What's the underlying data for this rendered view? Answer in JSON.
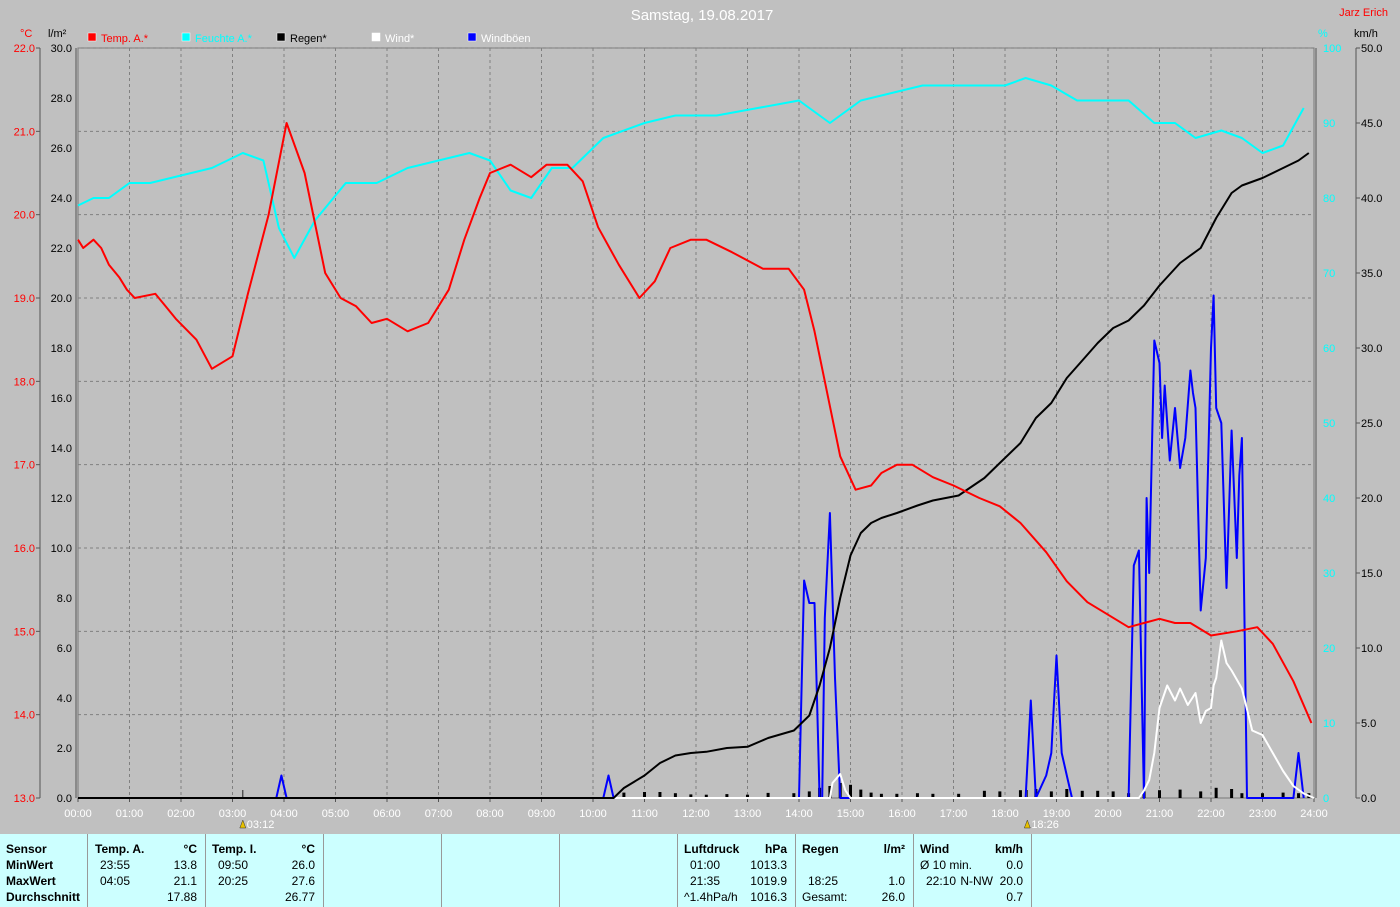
{
  "header": {
    "title": "Samstag, 19.08.2017",
    "author": "Jarz Erich"
  },
  "axes": {
    "left_outer_unit": "°C",
    "left_inner_unit": "l/m²",
    "right_inner_unit": "%",
    "right_outer_unit": "km/h",
    "temp_ticks": [
      "13.0",
      "14.0",
      "15.0",
      "16.0",
      "17.0",
      "18.0",
      "19.0",
      "20.0",
      "21.0",
      "22.0"
    ],
    "rain_ticks": [
      "0.0",
      "2.0",
      "4.0",
      "6.0",
      "8.0",
      "10.0",
      "12.0",
      "14.0",
      "16.0",
      "18.0",
      "20.0",
      "22.0",
      "24.0",
      "26.0",
      "28.0",
      "30.0"
    ],
    "hum_ticks": [
      "0",
      "10",
      "20",
      "30",
      "40",
      "50",
      "60",
      "70",
      "80",
      "90",
      "100"
    ],
    "wind_ticks": [
      "0.0",
      "5.0",
      "10.0",
      "15.0",
      "20.0",
      "25.0",
      "30.0",
      "35.0",
      "40.0",
      "45.0",
      "50.0"
    ],
    "time_ticks": [
      "00:00",
      "01:00",
      "02:00",
      "03:00",
      "04:00",
      "05:00",
      "06:00",
      "07:00",
      "08:00",
      "09:00",
      "10:00",
      "11:00",
      "12:00",
      "13:00",
      "14:00",
      "15:00",
      "16:00",
      "17:00",
      "18:00",
      "19:00",
      "20:00",
      "21:00",
      "22:00",
      "23:00",
      "24:00"
    ],
    "sunrise": "03:12",
    "sunset": "18:26"
  },
  "legend": [
    {
      "label": "Temp. A.*",
      "color": "#ff0000"
    },
    {
      "label": "Feuchte A.*",
      "color": "#00ffff"
    },
    {
      "label": "Regen*",
      "color": "#000000"
    },
    {
      "label": "Wind*",
      "color": "#ffffff"
    },
    {
      "label": "Windböen",
      "color": "#0000ff"
    }
  ],
  "chart_data": {
    "type": "line",
    "x_unit": "hours",
    "ylim_temp": [
      13.0,
      22.0
    ],
    "ylim_rain": [
      0,
      30
    ],
    "ylim_humidity": [
      0,
      100
    ],
    "ylim_wind": [
      0,
      50
    ],
    "series": [
      {
        "name": "Temp. A.*",
        "axis": "temp",
        "color": "#ff0000",
        "x": [
          0,
          0.1,
          0.3,
          0.45,
          0.6,
          0.8,
          0.95,
          1.1,
          1.5,
          1.7,
          1.9,
          2.3,
          2.6,
          3.0,
          3.3,
          3.7,
          4.05,
          4.4,
          4.8,
          5.1,
          5.4,
          5.7,
          6.0,
          6.4,
          6.8,
          7.2,
          7.5,
          7.8,
          8.0,
          8.4,
          8.8,
          9.1,
          9.5,
          9.8,
          10.1,
          10.5,
          10.9,
          11.2,
          11.5,
          11.9,
          12.2,
          12.7,
          13.3,
          13.8,
          14.1,
          14.3,
          14.5,
          14.8,
          15.1,
          15.4,
          15.6,
          15.9,
          16.2,
          16.6,
          17.0,
          17.5,
          17.9,
          18.3,
          18.8,
          19.2,
          19.6,
          20.0,
          20.4,
          20.7,
          21.0,
          21.3,
          21.6,
          22.0,
          22.5,
          22.9,
          23.2,
          23.6,
          23.95
        ],
        "y": [
          19.7,
          19.6,
          19.7,
          19.6,
          19.4,
          19.25,
          19.1,
          19.0,
          19.05,
          18.9,
          18.75,
          18.5,
          18.15,
          18.3,
          19.05,
          20.0,
          21.1,
          20.5,
          19.3,
          19.0,
          18.9,
          18.7,
          18.75,
          18.6,
          18.7,
          19.1,
          19.7,
          20.2,
          20.5,
          20.6,
          20.45,
          20.6,
          20.6,
          20.4,
          19.85,
          19.4,
          19.0,
          19.2,
          19.6,
          19.7,
          19.7,
          19.55,
          19.35,
          19.35,
          19.1,
          18.6,
          18.0,
          17.1,
          16.7,
          16.75,
          16.9,
          17.0,
          17.0,
          16.85,
          16.75,
          16.6,
          16.5,
          16.3,
          15.95,
          15.6,
          15.35,
          15.2,
          15.05,
          15.1,
          15.15,
          15.1,
          15.1,
          14.95,
          15.0,
          15.05,
          14.85,
          14.4,
          13.9
        ]
      },
      {
        "name": "Feuchte A.*",
        "axis": "humidity",
        "color": "#00ffff",
        "x": [
          0,
          0.3,
          0.6,
          1.0,
          1.4,
          2.0,
          2.6,
          3.2,
          3.6,
          3.9,
          4.2,
          4.6,
          5.2,
          5.8,
          6.4,
          7.0,
          7.6,
          8.0,
          8.4,
          8.8,
          9.2,
          9.6,
          10.2,
          11.0,
          11.6,
          12.4,
          13.2,
          14.0,
          14.6,
          15.2,
          15.8,
          16.4,
          17.2,
          18.0,
          18.4,
          18.9,
          19.4,
          20.0,
          20.4,
          20.9,
          21.3,
          21.7,
          22.2,
          22.6,
          23.0,
          23.4,
          23.8
        ],
        "y": [
          79,
          80,
          80,
          82,
          82,
          83,
          84,
          86,
          85,
          76,
          72,
          77,
          82,
          82,
          84,
          85,
          86,
          85,
          81,
          80,
          84,
          84,
          88,
          90,
          91,
          91,
          92,
          93,
          90,
          93,
          94,
          95,
          95,
          95,
          96,
          95,
          93,
          93,
          93,
          90,
          90,
          88,
          89,
          88,
          86,
          87,
          92
        ]
      },
      {
        "name": "Regen*",
        "axis": "rain",
        "color": "#000000",
        "x": [
          0,
          10.4,
          10.6,
          11.0,
          11.3,
          11.6,
          11.9,
          12.2,
          12.6,
          13.0,
          13.4,
          13.9,
          14.2,
          14.4,
          14.6,
          14.8,
          15.0,
          15.2,
          15.4,
          15.6,
          15.9,
          16.3,
          16.6,
          17.1,
          17.6,
          17.9,
          18.3,
          18.6,
          18.9,
          19.2,
          19.5,
          19.8,
          20.1,
          20.4,
          20.7,
          21.0,
          21.4,
          21.8,
          22.1,
          22.4,
          22.6,
          23.0,
          23.4,
          23.7,
          23.9
        ],
        "y": [
          0,
          0,
          0.4,
          0.9,
          1.4,
          1.7,
          1.8,
          1.85,
          2.0,
          2.05,
          2.4,
          2.7,
          3.3,
          4.5,
          6.0,
          8.0,
          9.7,
          10.6,
          11.0,
          11.2,
          11.4,
          11.7,
          11.9,
          12.1,
          12.8,
          13.4,
          14.2,
          15.2,
          15.8,
          16.8,
          17.5,
          18.2,
          18.8,
          19.1,
          19.7,
          20.5,
          21.4,
          22.0,
          23.2,
          24.2,
          24.5,
          24.8,
          25.2,
          25.5,
          25.8
        ]
      },
      {
        "name": "Wind*",
        "axis": "wind",
        "color": "#ffffff",
        "x": [
          0,
          14.6,
          14.65,
          14.8,
          14.9,
          15.0,
          20.6,
          20.7,
          20.8,
          20.9,
          21.0,
          21.15,
          21.3,
          21.4,
          21.55,
          21.7,
          21.8,
          21.9,
          22.0,
          22.05,
          22.1,
          22.2,
          22.3,
          22.4,
          22.6,
          22.8,
          23.0,
          23.2,
          23.4,
          23.6,
          23.8,
          24.0
        ],
        "y": [
          0,
          0,
          1.0,
          1.6,
          0.5,
          0,
          0,
          0.5,
          1.2,
          3.0,
          6.0,
          7.5,
          6.5,
          7.3,
          6.2,
          7.0,
          5.0,
          5.8,
          6.0,
          7.5,
          8.0,
          10.5,
          9.0,
          8.5,
          7.3,
          4.5,
          4.2,
          3.0,
          1.8,
          0.8,
          0.3,
          0
        ]
      },
      {
        "name": "Windböen",
        "axis": "wind",
        "color": "#0000ff",
        "x": [
          0,
          3.85,
          3.95,
          4.05,
          10.2,
          10.3,
          10.4,
          14.0,
          14.1,
          14.2,
          14.3,
          14.4,
          14.45,
          14.5,
          14.6,
          14.7,
          14.8,
          15.0,
          18.4,
          18.5,
          18.6,
          18.8,
          18.9,
          19.0,
          19.1,
          19.2,
          19.3,
          20.4,
          20.5,
          20.6,
          20.7,
          20.75,
          20.8,
          20.9,
          21.0,
          21.05,
          21.1,
          21.2,
          21.3,
          21.4,
          21.5,
          21.6,
          21.65,
          21.7,
          21.8,
          21.9,
          22.0,
          22.05,
          22.1,
          22.2,
          22.3,
          22.4,
          22.5,
          22.55,
          22.6,
          22.7,
          22.8,
          22.9,
          23.0,
          23.1,
          23.2,
          23.4,
          23.6,
          23.7,
          23.8
        ],
        "y": [
          0,
          0,
          1.5,
          0,
          0,
          1.5,
          0,
          0,
          14.5,
          13.0,
          13.0,
          0,
          0,
          12.0,
          19.0,
          8.0,
          0,
          0,
          0,
          6.5,
          0,
          1.5,
          3.0,
          9.5,
          3.0,
          1.5,
          0,
          0,
          15.5,
          16.5,
          0,
          20.0,
          15.0,
          30.5,
          29.0,
          24.0,
          27.5,
          22.5,
          26.0,
          22.0,
          24.0,
          28.5,
          27.0,
          26.0,
          12.5,
          16.0,
          30.0,
          33.5,
          26.0,
          25.0,
          14.0,
          24.5,
          16.0,
          21.5,
          24.0,
          0,
          0,
          0,
          0,
          0,
          0,
          0,
          0,
          3.0,
          0
        ]
      }
    ]
  },
  "stats": {
    "sensor_header": "Sensor",
    "row_labels": [
      "MinWert",
      "MaxWert",
      "Durchschnitt"
    ],
    "temp_a": {
      "title": "Temp. A.",
      "unit": "°C",
      "min_time": "23:55",
      "min_val": "13.8",
      "max_time": "04:05",
      "max_val": "21.1",
      "avg": "17.88"
    },
    "temp_i": {
      "title": "Temp. I.",
      "unit": "°C",
      "min_time": "09:50",
      "min_val": "26.0",
      "max_time": "20:25",
      "max_val": "27.6",
      "avg": "26.77"
    },
    "pressure": {
      "title": "Luftdruck",
      "unit": "hPa",
      "min_time": "01:00",
      "min_val": "1013.3",
      "max_time": "21:35",
      "max_val": "1019.9",
      "trend": "^1.4hPa/h",
      "avg": "1016.3"
    },
    "rain": {
      "title": "Regen",
      "unit": "l/m²",
      "max_time": "18:25",
      "max_val": "1.0",
      "total_label": "Gesamt:",
      "total": "26.0"
    },
    "wind": {
      "title": "Wind",
      "unit": "km/h",
      "avg_label": "Ø 10 min.",
      "avg10": "0.0",
      "max_time": "22:10",
      "max_dir": "N-NW",
      "max_val": "20.0",
      "avg": "0.7"
    }
  }
}
